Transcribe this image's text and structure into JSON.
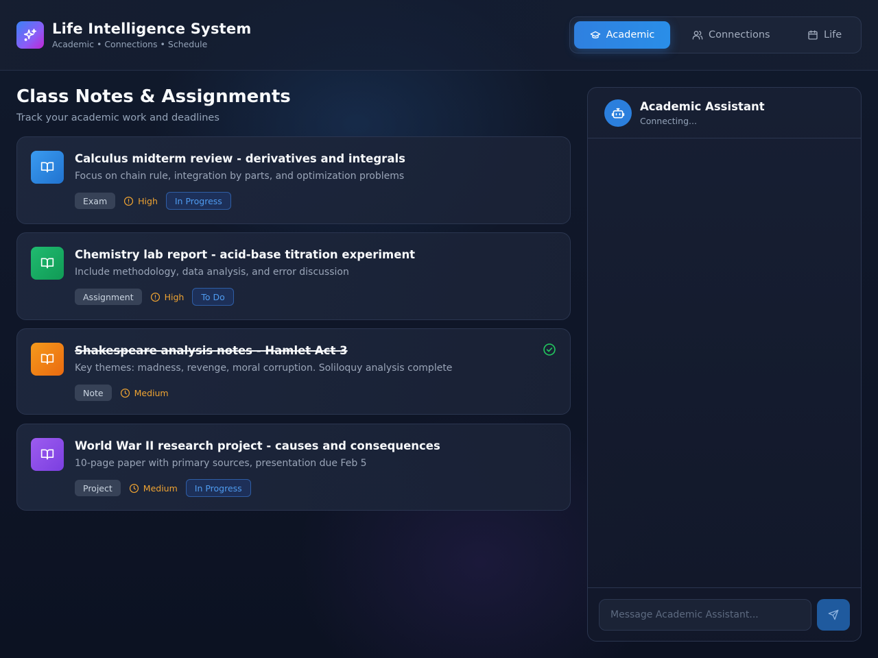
{
  "app": {
    "title": "Life Intelligence System",
    "subtitle": "Academic • Connections • Schedule",
    "icon": "sparkles-icon"
  },
  "nav": {
    "tabs": [
      {
        "label": "Academic",
        "icon": "graduation-cap-icon",
        "active": true
      },
      {
        "label": "Connections",
        "icon": "users-icon",
        "active": false
      },
      {
        "label": "Life",
        "icon": "calendar-icon",
        "active": false
      }
    ]
  },
  "main": {
    "title": "Class Notes & Assignments",
    "subtitle": "Track your academic work and deadlines",
    "items": [
      {
        "title": "Calculus midterm review - derivatives and integrals",
        "description": "Focus on chain rule, integration by parts, and optimization problems",
        "type": "Exam",
        "priority": "High",
        "status": "In Progress",
        "completed": false,
        "icon": "book-open-icon",
        "color": "#2b86e0"
      },
      {
        "title": "Chemistry lab report - acid-base titration experiment",
        "description": "Include methodology, data analysis, and error discussion",
        "type": "Assignment",
        "priority": "High",
        "status": "To Do",
        "completed": false,
        "icon": "book-open-icon",
        "color": "#16a862"
      },
      {
        "title": "Shakespeare analysis notes - Hamlet Act 3",
        "description": "Key themes: madness, revenge, moral corruption. Soliloquy analysis complete",
        "type": "Note",
        "priority": "Medium",
        "status": "",
        "completed": true,
        "icon": "book-open-icon",
        "color": "#f07a18"
      },
      {
        "title": "World War II research project - causes and consequences",
        "description": "10-page paper with primary sources, presentation due Feb 5",
        "type": "Project",
        "priority": "Medium",
        "status": "In Progress",
        "completed": false,
        "icon": "book-open-icon",
        "color": "#8b4fe6"
      }
    ]
  },
  "assistant": {
    "name": "Academic Assistant",
    "status": "Connecting...",
    "input_placeholder": "Message Academic Assistant...",
    "avatar_icon": "bot-icon",
    "send_icon": "send-icon"
  },
  "colors": {
    "accent": "#2f80e0",
    "priority": "#f0a432",
    "complete": "#22c55e"
  }
}
